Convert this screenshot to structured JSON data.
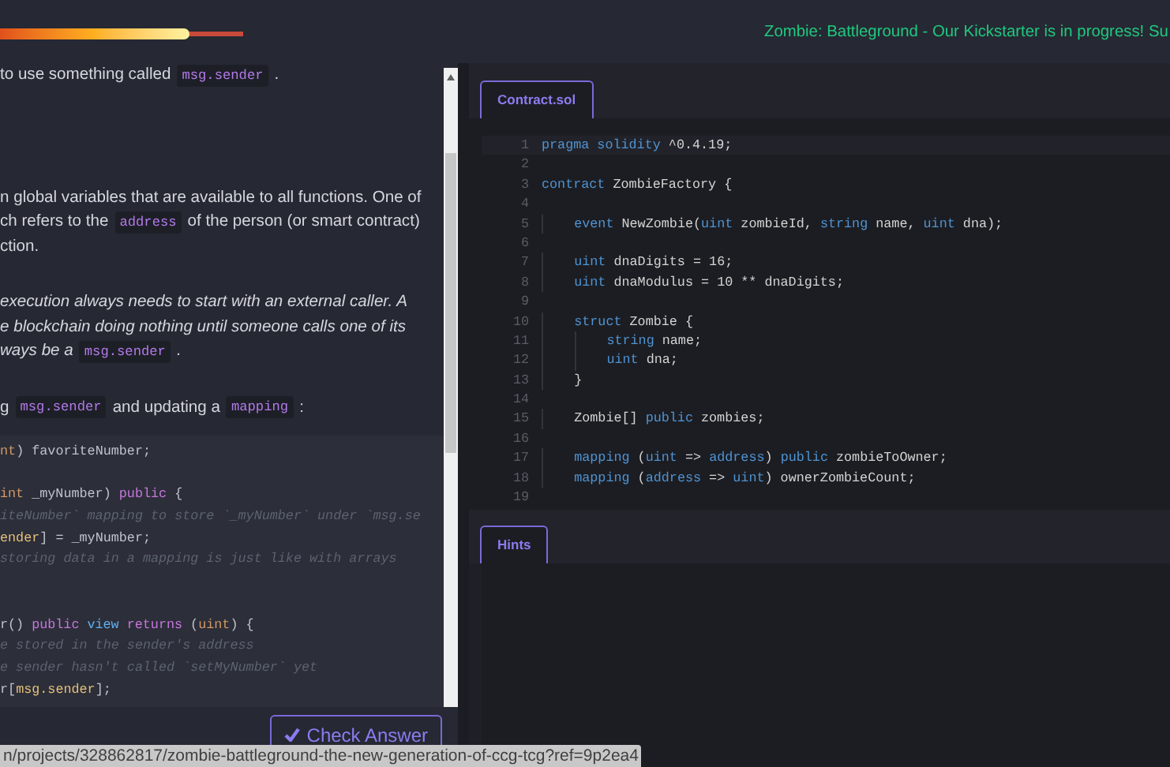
{
  "header": {
    "progress": {
      "level": 0.78
    },
    "announcement": "Zombie: Battleground - Our Kickstarter is in progress! Su"
  },
  "lesson": {
    "paragraphs": [
      {
        "kind": "plain",
        "lines": [
          [
            {
              "kind": "text",
              "text": "to use something called"
            },
            {
              "kind": "code",
              "text": "msg.sender"
            },
            {
              "kind": "text",
              "text": "."
            }
          ]
        ]
      },
      {
        "kind": "plain",
        "lines": [
          [
            {
              "kind": "text",
              "text": "n global variables that are available to all functions. One of"
            }
          ],
          [
            {
              "kind": "text",
              "text": "ch refers to the"
            },
            {
              "kind": "code",
              "text": "address"
            },
            {
              "kind": "text",
              "text": "of the person (or smart contract)"
            }
          ],
          [
            {
              "kind": "text",
              "text": "ction."
            }
          ]
        ]
      },
      {
        "kind": "italic",
        "lines": [
          [
            {
              "kind": "text",
              "text": "execution always needs to start with an external caller. A"
            }
          ],
          [
            {
              "kind": "text",
              "text": "e blockchain doing nothing until someone calls one of its"
            }
          ],
          [
            {
              "kind": "text",
              "text": "ways be a"
            },
            {
              "kind": "code",
              "text": "msg.sender"
            },
            {
              "kind": "text",
              "text": "."
            }
          ]
        ]
      },
      {
        "kind": "plain",
        "lines": [
          [
            {
              "kind": "text",
              "text": "g"
            },
            {
              "kind": "code",
              "text": "msg.sender"
            },
            {
              "kind": "text",
              "text": "and updating a"
            },
            {
              "kind": "code",
              "text": "mapping"
            },
            {
              "kind": "text",
              "text": ":"
            }
          ]
        ]
      }
    ],
    "example_code": [
      {
        "kind": "code",
        "tokens": [
          {
            "kind": "type",
            "text": "nt"
          },
          {
            "kind": "plain",
            "text": ") favoriteNumber;"
          }
        ]
      },
      {
        "kind": "blank"
      },
      {
        "kind": "code",
        "tokens": [
          {
            "kind": "type",
            "text": "int"
          },
          {
            "kind": "plain",
            "text": " _myNumber) "
          },
          {
            "kind": "keyword",
            "text": "public"
          },
          {
            "kind": "plain",
            "text": " {"
          }
        ]
      },
      {
        "kind": "code",
        "tokens": [
          {
            "kind": "comment",
            "text": "iteNumber` mapping to store `_myNumber` under `msg.se"
          }
        ]
      },
      {
        "kind": "code",
        "tokens": [
          {
            "kind": "var",
            "text": "ender"
          },
          {
            "kind": "plain",
            "text": "] = _myNumber;"
          }
        ]
      },
      {
        "kind": "code",
        "tokens": [
          {
            "kind": "comment",
            "text": "storing data in a mapping is just like with arrays"
          }
        ]
      },
      {
        "kind": "blank"
      },
      {
        "kind": "blank"
      },
      {
        "kind": "code",
        "tokens": [
          {
            "kind": "plain",
            "text": "r()"
          },
          {
            "kind": "space"
          },
          {
            "kind": "keyword",
            "text": "public"
          },
          {
            "kind": "space"
          },
          {
            "kind": "func",
            "text": "view"
          },
          {
            "kind": "space"
          },
          {
            "kind": "keyword",
            "text": "returns"
          },
          {
            "kind": "plain",
            "text": " ("
          },
          {
            "kind": "type",
            "text": "uint"
          },
          {
            "kind": "plain",
            "text": ") {"
          }
        ]
      },
      {
        "kind": "code",
        "tokens": [
          {
            "kind": "comment",
            "text": "e stored in the sender's address"
          }
        ]
      },
      {
        "kind": "code",
        "tokens": [
          {
            "kind": "comment",
            "text": "e sender hasn't called `setMyNumber` yet"
          }
        ]
      },
      {
        "kind": "code",
        "tokens": [
          {
            "kind": "plain",
            "text": "r["
          },
          {
            "kind": "var",
            "text": "msg.sender"
          },
          {
            "kind": "plain",
            "text": "];"
          }
        ]
      }
    ],
    "check_button": "Check Answer"
  },
  "status_url": "n/projects/328862817/zombie-battleground-the-new-generation-of-ccg-tcg?ref=9p2ea4",
  "editor": {
    "tabs": [
      {
        "label": "Contract.sol",
        "selected": true
      }
    ],
    "lines": [
      {
        "number": "1",
        "tokens": [
          {
            "kind": "keyword",
            "text": "pragma solidity"
          },
          {
            "kind": "plain",
            "text": " ^0.4.19;"
          }
        ]
      },
      {
        "number": "2"
      },
      {
        "number": "3",
        "tokens": [
          {
            "kind": "keyword",
            "text": "contract"
          },
          {
            "kind": "plain",
            "text": " ZombieFactory {"
          }
        ]
      },
      {
        "number": "4"
      },
      {
        "number": "5",
        "tokens": [
          {
            "kind": "indent"
          },
          {
            "kind": "keyword",
            "text": "event"
          },
          {
            "kind": "plain",
            "text": " NewZombie("
          },
          {
            "kind": "keyword",
            "text": "uint"
          },
          {
            "kind": "plain",
            "text": " zombieId, "
          },
          {
            "kind": "keyword",
            "text": "string"
          },
          {
            "kind": "plain",
            "text": " name, "
          },
          {
            "kind": "keyword",
            "text": "uint"
          },
          {
            "kind": "plain",
            "text": " dna);"
          }
        ]
      },
      {
        "number": "6"
      },
      {
        "number": "7",
        "tokens": [
          {
            "kind": "indent"
          },
          {
            "kind": "keyword",
            "text": "uint"
          },
          {
            "kind": "plain",
            "text": " dnaDigits = 16;"
          }
        ]
      },
      {
        "number": "8",
        "tokens": [
          {
            "kind": "indent"
          },
          {
            "kind": "keyword",
            "text": "uint"
          },
          {
            "kind": "plain",
            "text": " dnaModulus = 10 ** dnaDigits;"
          }
        ]
      },
      {
        "number": "9"
      },
      {
        "number": "10",
        "tokens": [
          {
            "kind": "indent"
          },
          {
            "kind": "keyword",
            "text": "struct"
          },
          {
            "kind": "plain",
            "text": " Zombie {"
          }
        ]
      },
      {
        "number": "11",
        "tokens": [
          {
            "kind": "indent"
          },
          {
            "kind": "indent"
          },
          {
            "kind": "keyword",
            "text": "string"
          },
          {
            "kind": "plain",
            "text": " name;"
          }
        ]
      },
      {
        "number": "12",
        "tokens": [
          {
            "kind": "indent"
          },
          {
            "kind": "indent"
          },
          {
            "kind": "keyword",
            "text": "uint"
          },
          {
            "kind": "plain",
            "text": " dna;"
          }
        ]
      },
      {
        "number": "13",
        "tokens": [
          {
            "kind": "indent"
          },
          {
            "kind": "plain",
            "text": "}"
          }
        ]
      },
      {
        "number": "14"
      },
      {
        "number": "15",
        "tokens": [
          {
            "kind": "indent"
          },
          {
            "kind": "plain",
            "text": "Zombie[] "
          },
          {
            "kind": "keyword",
            "text": "public"
          },
          {
            "kind": "plain",
            "text": " zombies;"
          }
        ]
      },
      {
        "number": "16"
      },
      {
        "number": "17",
        "tokens": [
          {
            "kind": "indent"
          },
          {
            "kind": "keyword",
            "text": "mapping"
          },
          {
            "kind": "plain",
            "text": " ("
          },
          {
            "kind": "keyword",
            "text": "uint"
          },
          {
            "kind": "plain",
            "text": " => "
          },
          {
            "kind": "keyword",
            "text": "address"
          },
          {
            "kind": "plain",
            "text": ") "
          },
          {
            "kind": "keyword",
            "text": "public"
          },
          {
            "kind": "plain",
            "text": " zombieToOwner;"
          }
        ]
      },
      {
        "number": "18",
        "tokens": [
          {
            "kind": "indent"
          },
          {
            "kind": "keyword",
            "text": "mapping"
          },
          {
            "kind": "plain",
            "text": " ("
          },
          {
            "kind": "keyword",
            "text": "address"
          },
          {
            "kind": "plain",
            "text": " => "
          },
          {
            "kind": "keyword",
            "text": "uint"
          },
          {
            "kind": "plain",
            "text": ") ownerZombieCount;"
          }
        ]
      },
      {
        "number": "19"
      }
    ]
  },
  "hints": {
    "tabs": [
      {
        "label": "Hints",
        "selected": true
      }
    ]
  }
}
